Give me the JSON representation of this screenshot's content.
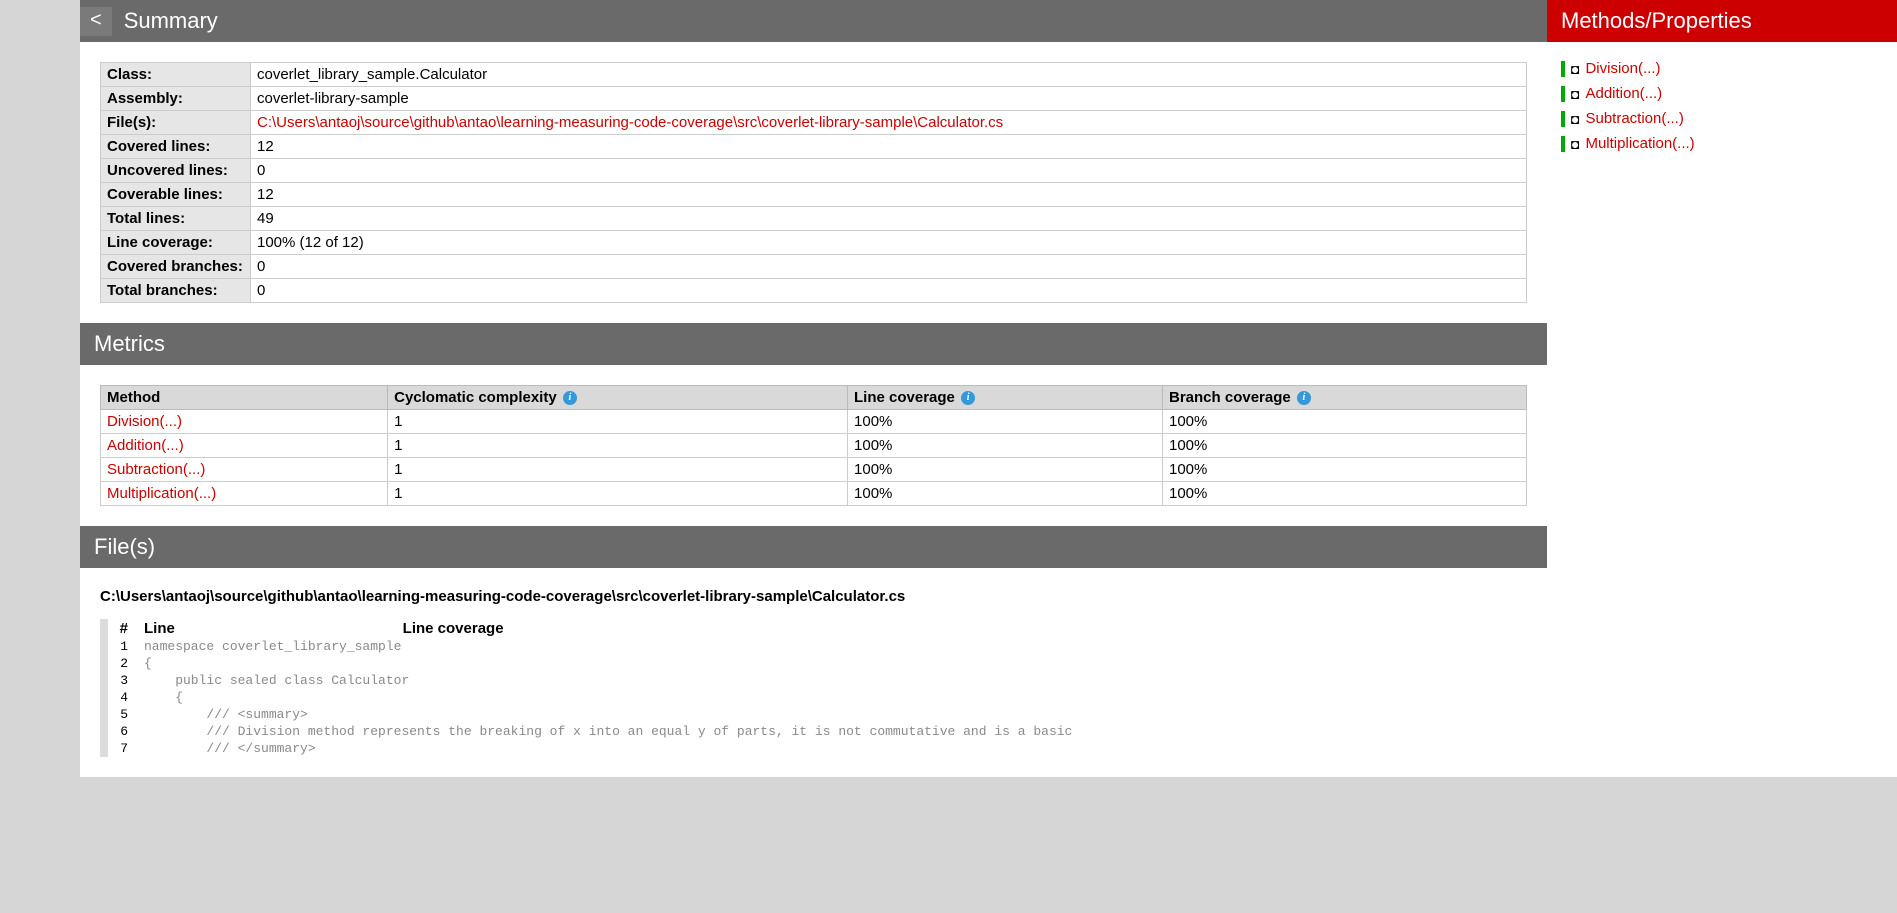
{
  "headers": {
    "summary": "Summary",
    "metrics": "Metrics",
    "files": "File(s)",
    "sidebar": "Methods/Properties"
  },
  "back": "<",
  "summary": {
    "rows": [
      {
        "label": "Class:",
        "value": "coverlet_library_sample.Calculator",
        "link": false
      },
      {
        "label": "Assembly:",
        "value": "coverlet-library-sample",
        "link": false
      },
      {
        "label": "File(s):",
        "value": "C:\\Users\\antaoj\\source\\github\\antao\\learning-measuring-code-coverage\\src\\coverlet-library-sample\\Calculator.cs",
        "link": true
      },
      {
        "label": "Covered lines:",
        "value": "12",
        "link": false
      },
      {
        "label": "Uncovered lines:",
        "value": "0",
        "link": false
      },
      {
        "label": "Coverable lines:",
        "value": "12",
        "link": false
      },
      {
        "label": "Total lines:",
        "value": "49",
        "link": false
      },
      {
        "label": "Line coverage:",
        "value": "100% (12 of 12)",
        "link": false
      },
      {
        "label": "Covered branches:",
        "value": "0",
        "link": false
      },
      {
        "label": "Total branches:",
        "value": "0",
        "link": false
      }
    ]
  },
  "metrics": {
    "cols": [
      "Method",
      "Cyclomatic complexity",
      "Line coverage",
      "Branch coverage"
    ],
    "rows": [
      {
        "method": "Division(...)",
        "cc": "1",
        "lc": "100%",
        "bc": "100%"
      },
      {
        "method": "Addition(...)",
        "cc": "1",
        "lc": "100%",
        "bc": "100%"
      },
      {
        "method": "Subtraction(...)",
        "cc": "1",
        "lc": "100%",
        "bc": "100%"
      },
      {
        "method": "Multiplication(...)",
        "cc": "1",
        "lc": "100%",
        "bc": "100%"
      }
    ]
  },
  "file": {
    "path": "C:\\Users\\antaoj\\source\\github\\antao\\learning-measuring-code-coverage\\src\\coverlet-library-sample\\Calculator.cs",
    "head_num": "#",
    "head_line": "Line",
    "head_cov": "Line coverage",
    "lines": [
      {
        "n": "1",
        "src": "namespace coverlet_library_sample"
      },
      {
        "n": "2",
        "src": "{"
      },
      {
        "n": "3",
        "src": "    public sealed class Calculator"
      },
      {
        "n": "4",
        "src": "    {"
      },
      {
        "n": "5",
        "src": "        /// <summary>"
      },
      {
        "n": "6",
        "src": "        /// Division method represents the breaking of x into an equal y of parts, it is not commutative and is a basic"
      },
      {
        "n": "7",
        "src": "        /// </summary>"
      }
    ]
  },
  "methods": [
    "Division(...)",
    "Addition(...)",
    "Subtraction(...)",
    "Multiplication(...)"
  ]
}
